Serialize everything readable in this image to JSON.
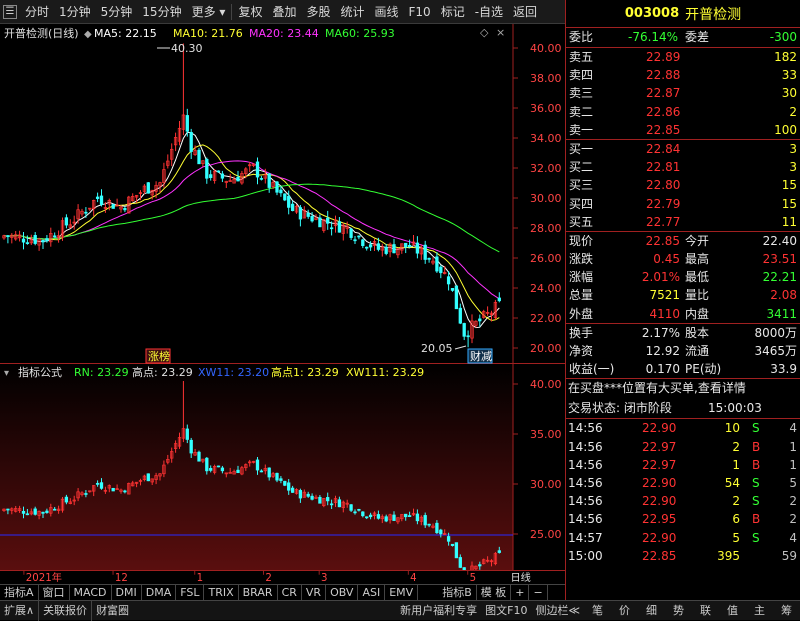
{
  "toolbar": {
    "items": [
      "分时",
      "1分钟",
      "5分钟",
      "15分钟",
      "更多",
      "复权",
      "叠加",
      "多股",
      "统计",
      "画线",
      "F10",
      "标记",
      "-自选",
      "返回"
    ]
  },
  "main_legend": {
    "title": "开普检测(日线)",
    "ma5": "MA5: 22.15",
    "ma10": "MA10: 21.76",
    "ma20": "MA20: 23.44",
    "ma60": "MA60: 25.93"
  },
  "annotations": {
    "high": "40.30",
    "low": "20.05",
    "tag1": "涨榜",
    "tag2": "财减"
  },
  "ind_legend": {
    "title": "指标公式",
    "rn": "RN: 23.29",
    "gd": "高点: 23.29",
    "xw11": "XW11: 23.20",
    "gd1": "高点1: 23.29",
    "xw111": "XW111: 23.29"
  },
  "time_axis": {
    "labels": [
      "2021年",
      "12",
      "1",
      "2",
      "3",
      "4",
      "5"
    ],
    "right": "日线"
  },
  "tabs": [
    "指标A",
    "窗口",
    "MACD",
    "DMI",
    "DMA",
    "FSL",
    "TRIX",
    "BRAR",
    "CR",
    "VR",
    "OBV",
    "ASI",
    "EMV",
    "指标B",
    "模 板",
    "+",
    "−"
  ],
  "status": {
    "left": [
      "扩展∧",
      "关联报价",
      "财富圈"
    ],
    "right": [
      "新用户福利专享",
      "图文F10",
      "侧边栏≪",
      "笔",
      "价",
      "细",
      "势",
      "联",
      "值",
      "主",
      "筹"
    ]
  },
  "quote": {
    "code": "003008",
    "name": "开普检测",
    "weibi_label": "委比",
    "weibi": "-76.14%",
    "weicha_label": "委差",
    "weicha": "-300",
    "asks": [
      {
        "l": "卖五",
        "p": "22.89",
        "v": "182"
      },
      {
        "l": "卖四",
        "p": "22.88",
        "v": "33"
      },
      {
        "l": "卖三",
        "p": "22.87",
        "v": "30"
      },
      {
        "l": "卖二",
        "p": "22.86",
        "v": "2"
      },
      {
        "l": "卖一",
        "p": "22.85",
        "v": "100"
      }
    ],
    "bids": [
      {
        "l": "买一",
        "p": "22.84",
        "v": "3"
      },
      {
        "l": "买二",
        "p": "22.81",
        "v": "3"
      },
      {
        "l": "买三",
        "p": "22.80",
        "v": "15"
      },
      {
        "l": "买四",
        "p": "22.79",
        "v": "15"
      },
      {
        "l": "买五",
        "p": "22.77",
        "v": "11"
      }
    ],
    "stats": [
      [
        "现价",
        "22.85",
        "今开",
        "22.40"
      ],
      [
        "涨跌",
        "0.45",
        "最高",
        "23.51"
      ],
      [
        "涨幅",
        "2.01%",
        "最低",
        "22.21"
      ],
      [
        "总量",
        "7521",
        "量比",
        "2.08"
      ],
      [
        "外盘",
        "4110",
        "内盘",
        "3411"
      ]
    ],
    "stats2": [
      [
        "换手",
        "2.17%",
        "股本",
        "8000万"
      ],
      [
        "净资",
        "12.92",
        "流通",
        "3465万"
      ],
      [
        "收益(一)",
        "0.170",
        "PE(动)",
        "33.9"
      ]
    ],
    "notice": "在买盘***位置有大买单,查看详情",
    "phase_label": "交易状态: 闭市阶段",
    "phase_time": "15:00:03",
    "ticks": [
      {
        "t": "14:56",
        "p": "22.90",
        "v": "10",
        "d": "S",
        "n": "4"
      },
      {
        "t": "14:56",
        "p": "22.97",
        "v": "2",
        "d": "B",
        "n": "1"
      },
      {
        "t": "14:56",
        "p": "22.97",
        "v": "1",
        "d": "B",
        "n": "1"
      },
      {
        "t": "14:56",
        "p": "22.90",
        "v": "54",
        "d": "S",
        "n": "5"
      },
      {
        "t": "14:56",
        "p": "22.90",
        "v": "2",
        "d": "S",
        "n": "2"
      },
      {
        "t": "14:56",
        "p": "22.95",
        "v": "6",
        "d": "B",
        "n": "2"
      },
      {
        "t": "14:57",
        "p": "22.90",
        "v": "5",
        "d": "S",
        "n": "4"
      },
      {
        "t": "15:00",
        "p": "22.85",
        "v": "395",
        "d": "",
        "n": "59"
      }
    ]
  },
  "colors": {
    "up": "#ff3333",
    "down": "#33ffff",
    "ma5": "#ffffff",
    "ma10": "#ffff33",
    "ma20": "#ff33ff",
    "ma60": "#33ff33",
    "frame": "#a02020"
  }
}
